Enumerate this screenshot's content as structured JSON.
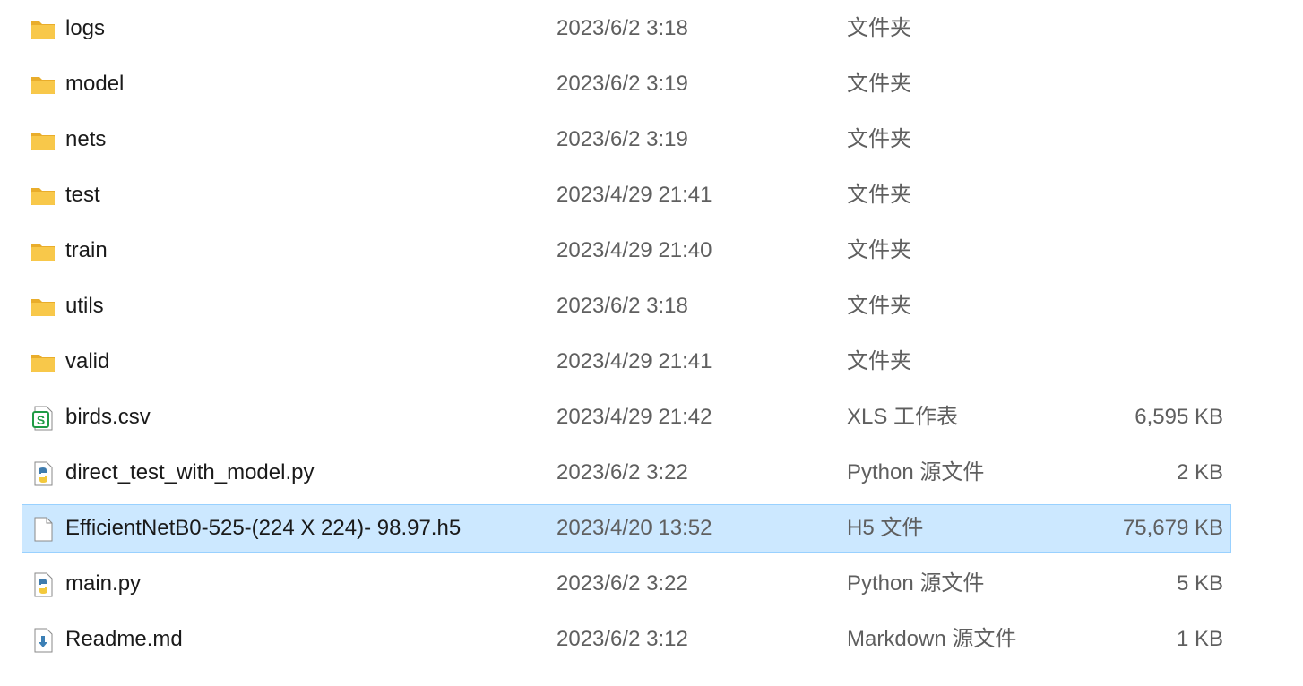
{
  "rows": [
    {
      "name": "logs",
      "date": "2023/6/2 3:18",
      "type": "文件夹",
      "size": "",
      "icon": "folder-icon"
    },
    {
      "name": "model",
      "date": "2023/6/2 3:19",
      "type": "文件夹",
      "size": "",
      "icon": "folder-icon"
    },
    {
      "name": "nets",
      "date": "2023/6/2 3:19",
      "type": "文件夹",
      "size": "",
      "icon": "folder-icon"
    },
    {
      "name": "test",
      "date": "2023/4/29 21:41",
      "type": "文件夹",
      "size": "",
      "icon": "folder-icon"
    },
    {
      "name": "train",
      "date": "2023/4/29 21:40",
      "type": "文件夹",
      "size": "",
      "icon": "folder-icon"
    },
    {
      "name": "utils",
      "date": "2023/6/2 3:18",
      "type": "文件夹",
      "size": "",
      "icon": "folder-icon"
    },
    {
      "name": "valid",
      "date": "2023/4/29 21:41",
      "type": "文件夹",
      "size": "",
      "icon": "folder-icon"
    },
    {
      "name": "birds.csv",
      "date": "2023/4/29 21:42",
      "type": "XLS 工作表",
      "size": "6,595 KB",
      "icon": "spreadsheet-file-icon"
    },
    {
      "name": "direct_test_with_model.py",
      "date": "2023/6/2 3:22",
      "type": "Python 源文件",
      "size": "2 KB",
      "icon": "python-file-icon"
    },
    {
      "name": "EfficientNetB0-525-(224 X 224)- 98.97.h5",
      "date": "2023/4/20 13:52",
      "type": "H5 文件",
      "size": "75,679 KB",
      "icon": "blank-file-icon",
      "selected": true
    },
    {
      "name": "main.py",
      "date": "2023/6/2 3:22",
      "type": "Python 源文件",
      "size": "5 KB",
      "icon": "python-file-icon"
    },
    {
      "name": "Readme.md",
      "date": "2023/6/2 3:12",
      "type": "Markdown 源文件",
      "size": "1 KB",
      "icon": "markdown-file-icon"
    }
  ],
  "colors": {
    "selection_bg": "#cce8ff",
    "selection_border": "#99d1ff",
    "folder": "#f8c84a",
    "spreadsheet": "#1f9b45",
    "python_blue": "#3f7cae",
    "python_yellow": "#f3c93c",
    "markdown": "#3b7fb5"
  }
}
